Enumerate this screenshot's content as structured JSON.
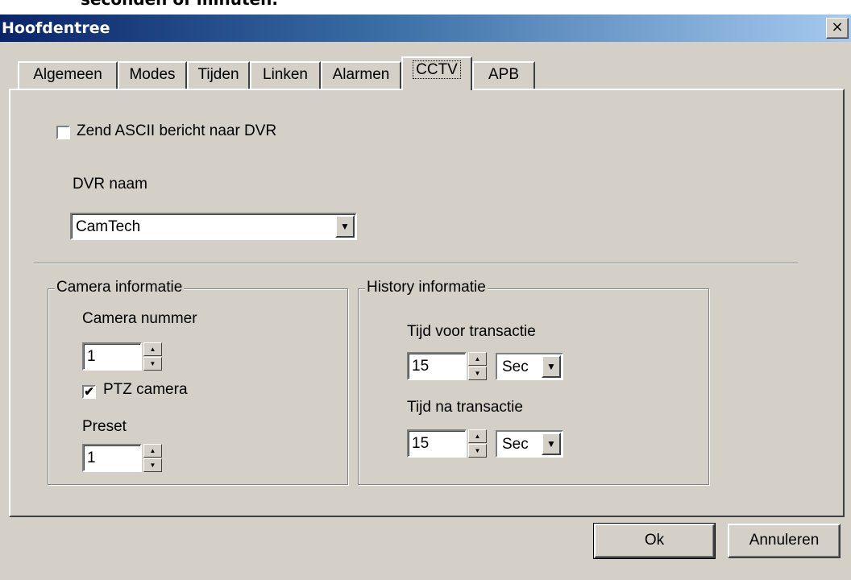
{
  "background_text": "seconden of minuten.",
  "window": {
    "title": "Hoofdentree",
    "close_symbol": "×"
  },
  "tabs": [
    {
      "label": "Algemeen"
    },
    {
      "label": "Modes"
    },
    {
      "label": "Tijden"
    },
    {
      "label": "Linken"
    },
    {
      "label": "Alarmen"
    },
    {
      "label": "CCTV",
      "active": true
    },
    {
      "label": "APB"
    }
  ],
  "cctv": {
    "send_ascii_label": "Zend ASCII bericht naar DVR",
    "send_ascii_checked": false,
    "dvr_label": "DVR naam",
    "dvr_value": "CamTech"
  },
  "camera": {
    "group_label": "Camera informatie",
    "number_label": "Camera nummer",
    "number_value": "1",
    "ptz_label": "PTZ camera",
    "ptz_checked": true,
    "ptz_mark": "✔",
    "preset_label": "Preset",
    "preset_value": "1"
  },
  "history": {
    "group_label": "History informatie",
    "before_label": "Tijd voor transactie",
    "before_value": "15",
    "before_unit": "Sec",
    "after_label": "Tijd na transactie",
    "after_value": "15",
    "after_unit": "Sec"
  },
  "buttons": {
    "ok": "Ok",
    "cancel": "Annuleren"
  },
  "icons": {
    "dropdown_arrow": "▼",
    "spin_up": "▲",
    "spin_down": "▼"
  }
}
